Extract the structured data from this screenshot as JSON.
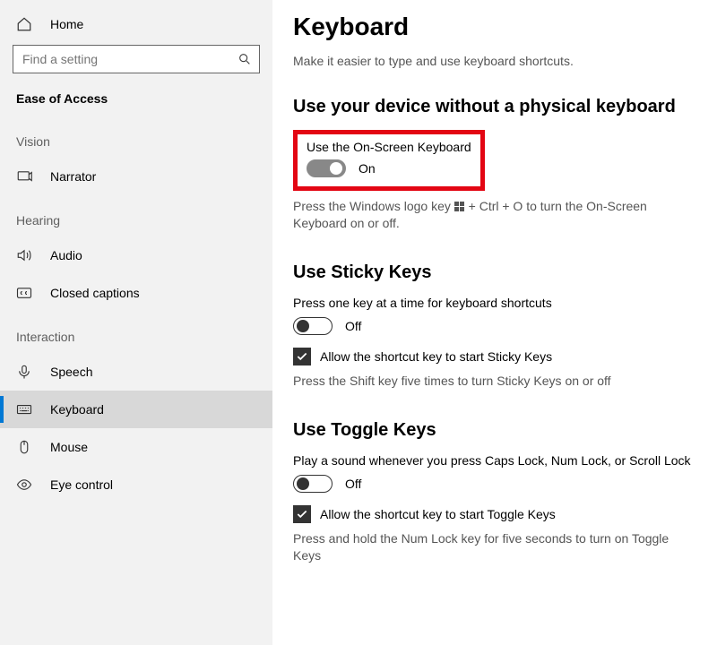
{
  "sidebar": {
    "home": "Home",
    "search_placeholder": "Find a setting",
    "section": "Ease of Access",
    "groups": {
      "vision": "Vision",
      "hearing": "Hearing",
      "interaction": "Interaction"
    },
    "items": {
      "narrator": "Narrator",
      "audio": "Audio",
      "closed_captions": "Closed captions",
      "speech": "Speech",
      "keyboard": "Keyboard",
      "mouse": "Mouse",
      "eye_control": "Eye control"
    }
  },
  "page": {
    "title": "Keyboard",
    "tagline": "Make it easier to type and use keyboard shortcuts."
  },
  "osk": {
    "heading": "Use your device without a physical keyboard",
    "label": "Use the On-Screen Keyboard",
    "state": "On",
    "hint_pre": "Press the Windows logo key ",
    "hint_post": " + Ctrl + O to turn the On-Screen Keyboard on or off."
  },
  "sticky": {
    "heading": "Use Sticky Keys",
    "desc": "Press one key at a time for keyboard shortcuts",
    "state": "Off",
    "check_label": "Allow the shortcut key to start Sticky Keys",
    "hint": "Press the Shift key five times to turn Sticky Keys on or off"
  },
  "togglekeys": {
    "heading": "Use Toggle Keys",
    "desc": "Play a sound whenever you press Caps Lock, Num Lock, or Scroll Lock",
    "state": "Off",
    "check_label": "Allow the shortcut key to start Toggle Keys",
    "hint": "Press and hold the Num Lock key for five seconds to turn on Toggle Keys"
  }
}
